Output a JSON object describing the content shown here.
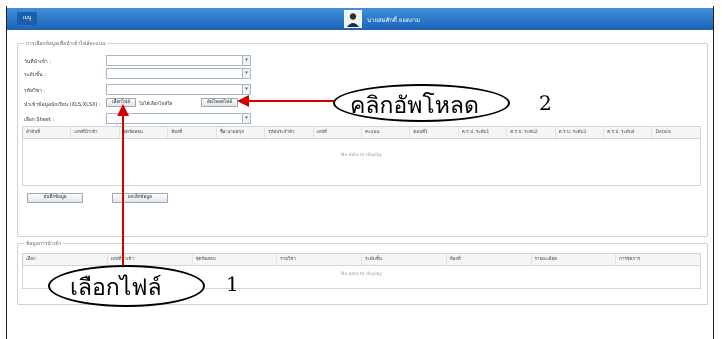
{
  "topbar": {
    "menu_label": "เมนู",
    "username": "นายสมศักดิ์ ยอดงาม"
  },
  "section1": {
    "legend": "การเลือกข้อมูลเพื่อนำเข้าไฟล์คะแนน",
    "fields": [
      {
        "label": "วันที่นำเข้า :",
        "value": ""
      },
      {
        "label": "ระดับชั้น :",
        "value": ""
      },
      {
        "label": "รหัสวิชา :",
        "value": ""
      }
    ],
    "upload_label": "นำเข้าข้อมูลนักเรียน (XLS,XLSX) :",
    "choose_file_button": "เลือกไฟล์",
    "no_file_text": "ไม่ได้เลือกไฟล์ใด",
    "upload_button": "อัพโหลดไฟล์",
    "sheet_label": "เลือก Sheet :",
    "columns": [
      "ลำดับที่",
      "เลขที่นำเข้า",
      "ชุดข้อสอบ",
      "ห้องที่",
      "ชื่อ-นามสกุล",
      "รหัสประจำตัว",
      "เลขที่",
      "คะแนน",
      "ตอนที่1",
      "ค.ร.ป. ระดับ1",
      "ค.ร.ป. ระดับ2",
      "ค.ร.ป. ระดับ3",
      "ค.ร.ป. ระดับ4",
      "Details"
    ],
    "no_data": "No data to display",
    "save_button": "บันทึกข้อมูล",
    "cancel_button": "ยกเลิกข้อมูล"
  },
  "section2": {
    "legend": "ข้อมูลการนำเข้า",
    "columns": [
      "เลือก",
      "เลขที่นำเข้า",
      "ชุดข้อสอบ",
      "รายวิชา",
      "ระดับชั้น",
      "ห้องที่",
      "รายละเอียด",
      "การจัดการ"
    ],
    "no_data": "No data to display"
  },
  "annotations": {
    "upload_callout": "คลิกอัพโหลด",
    "upload_step": "2",
    "choose_callout": "เลือกไฟล์",
    "choose_step": "1"
  }
}
